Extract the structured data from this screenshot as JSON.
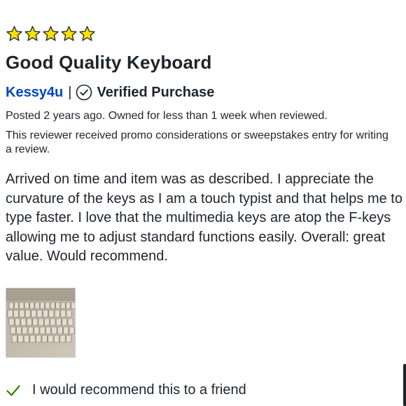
{
  "review": {
    "rating": 5,
    "max_rating": 5,
    "star_color": "#ffe000",
    "title": "Good Quality Keyboard",
    "author": "Kessy4u",
    "separator": "|",
    "verified_label": "Verified Purchase",
    "posted": "Posted 2 years ago. Owned for less than 1 week when reviewed.",
    "promo_notice": "This reviewer received promo considerations or sweepstakes entry for writing a review.",
    "body": "Arrived on time and item was as described. I appreciate the curvature of the keys as I am a touch typist and that helps me to type faster. I love that the multimedia keys are atop the F-keys allowing me to adjust standard functions easily. Overall: great value. Would recommend.",
    "photo_icon": "keyboard-photo",
    "recommend": "I would recommend this to a friend",
    "recommend_icon": "checkmark-icon",
    "recommend_color": "#318000"
  },
  "colors": {
    "text": "#1d252c",
    "link": "#0046be"
  }
}
